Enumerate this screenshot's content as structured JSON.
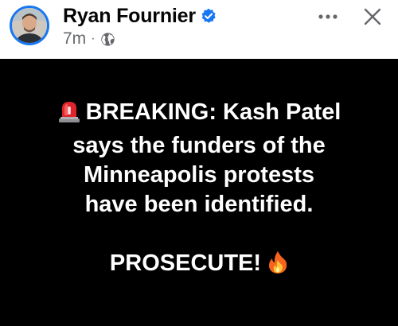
{
  "header": {
    "author_name": "Ryan Fournier",
    "timestamp": "7m",
    "separator": "·",
    "audience_icon": "globe-icon",
    "verified_icon": "verified-badge-icon",
    "more_icon": "more-options-icon",
    "close_icon": "close-icon",
    "accent_color": "#1877f2"
  },
  "post": {
    "background_color": "#000000",
    "text_color": "#ffffff",
    "siren_icon": "siren-emoji-icon",
    "fire_icon": "fire-emoji-icon",
    "lines": [
      "BREAKING: Kash Patel",
      "says the funders of the",
      "Minneapolis protests",
      "have been identified."
    ],
    "closing": "PROSECUTE!"
  }
}
